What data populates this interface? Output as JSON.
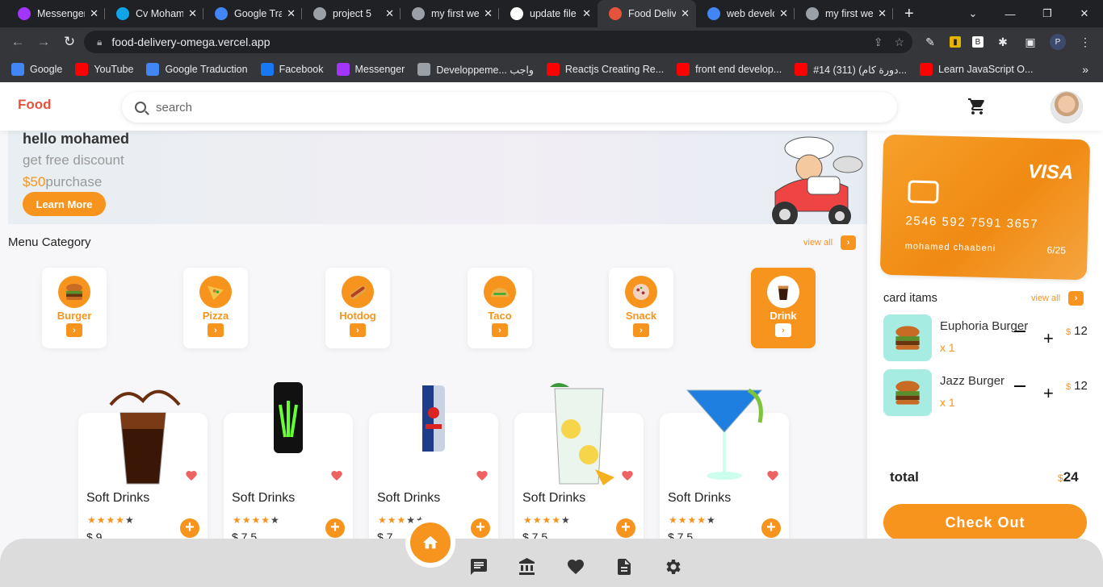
{
  "browser": {
    "tabs": [
      {
        "title": "Messenger",
        "icon": "messenger-icon",
        "color": "#a334fa"
      },
      {
        "title": "Cv Moham",
        "icon": "canva-icon",
        "color": "#0ea5e9"
      },
      {
        "title": "Google Tra",
        "icon": "google-translate-icon",
        "color": "#4285f4"
      },
      {
        "title": "project 5",
        "icon": "globe-icon",
        "color": "#9aa0a6"
      },
      {
        "title": "my first we",
        "icon": "globe-icon",
        "color": "#9aa0a6"
      },
      {
        "title": "update file",
        "icon": "github-icon",
        "color": "#ffffff"
      },
      {
        "title": "Food Deliv",
        "icon": "food-icon",
        "color": "#e5533d"
      },
      {
        "title": "web develo",
        "icon": "google-icon",
        "color": "#4285f4"
      },
      {
        "title": "my first we",
        "icon": "globe-icon",
        "color": "#9aa0a6"
      }
    ],
    "url": "food-delivery-omega.vercel.app",
    "bookmarks": [
      {
        "label": "Google",
        "icon": "google-icon",
        "color": "#4285f4"
      },
      {
        "label": "YouTube",
        "icon": "youtube-icon",
        "color": "#ff0000"
      },
      {
        "label": "Google Traduction",
        "icon": "google-translate-icon",
        "color": "#4285f4"
      },
      {
        "label": "Facebook",
        "icon": "facebook-icon",
        "color": "#1877f2"
      },
      {
        "label": "Messenger",
        "icon": "messenger-icon",
        "color": "#a334fa"
      },
      {
        "label": "Developpeme... واجب",
        "icon": "page-icon",
        "color": "#9aa0a6"
      },
      {
        "label": "Reactjs Creating Re...",
        "icon": "youtube-icon",
        "color": "#ff0000"
      },
      {
        "label": "front end develop...",
        "icon": "youtube-icon",
        "color": "#ff0000"
      },
      {
        "label": "#14 (311) (دورة كام...",
        "icon": "youtube-icon",
        "color": "#ff0000"
      },
      {
        "label": "Learn JavaScript O...",
        "icon": "youtube-icon",
        "color": "#ff0000"
      }
    ]
  },
  "app": {
    "logo": "Food",
    "search_placeholder": "search",
    "banner": {
      "greeting": "hello mohamed",
      "line1": "get free discount",
      "amount": "$50",
      "line2_suffix": "purchase",
      "button": "Learn More"
    },
    "menu_category": {
      "title": "Menu Category",
      "view_all": "view all",
      "items": [
        {
          "label": "Burger",
          "icon": "burger-icon",
          "active": false
        },
        {
          "label": "Pizza",
          "icon": "pizza-icon",
          "active": false
        },
        {
          "label": "Hotdog",
          "icon": "hotdog-icon",
          "active": false
        },
        {
          "label": "Taco",
          "icon": "taco-icon",
          "active": false
        },
        {
          "label": "Snack",
          "icon": "snack-icon",
          "active": false
        },
        {
          "label": "Drink",
          "icon": "drink-icon",
          "active": true
        }
      ]
    },
    "products": [
      {
        "name": "Soft Drinks",
        "rating": 4,
        "price": "$ 9",
        "image": "cola-glass-image"
      },
      {
        "name": "Soft Drinks",
        "rating": 4,
        "price": "$ 7.5",
        "image": "monster-can-image"
      },
      {
        "name": "Soft Drinks",
        "rating": 3,
        "price": "$ 7",
        "image": "redbull-can-image"
      },
      {
        "name": "Soft Drinks",
        "rating": 4,
        "price": "$ 7.5",
        "image": "lemonade-glass-image"
      },
      {
        "name": "Soft Drinks",
        "rating": 4,
        "price": "$ 7.5",
        "image": "blue-cocktail-image"
      }
    ],
    "card": {
      "brand": "VISA",
      "number": "2546 592 7591 3657",
      "holder": "mohamed chaabeni",
      "expiry": "6/25"
    },
    "cart_items": {
      "title": "card itams",
      "view_all": "view all",
      "items": [
        {
          "name": "Euphoria Burger",
          "qty": "x 1",
          "currency": "$",
          "price": "12"
        },
        {
          "name": "Jazz Burger",
          "qty": "x 1",
          "currency": "$",
          "price": "12"
        }
      ]
    },
    "total": {
      "label": "total",
      "currency": "$",
      "value": "24"
    },
    "checkout": "Check Out",
    "bottom_nav": [
      "home-icon",
      "chat-icon",
      "bank-icon",
      "heart-icon",
      "document-icon",
      "settings-icon"
    ],
    "accent": "#f7941d"
  }
}
